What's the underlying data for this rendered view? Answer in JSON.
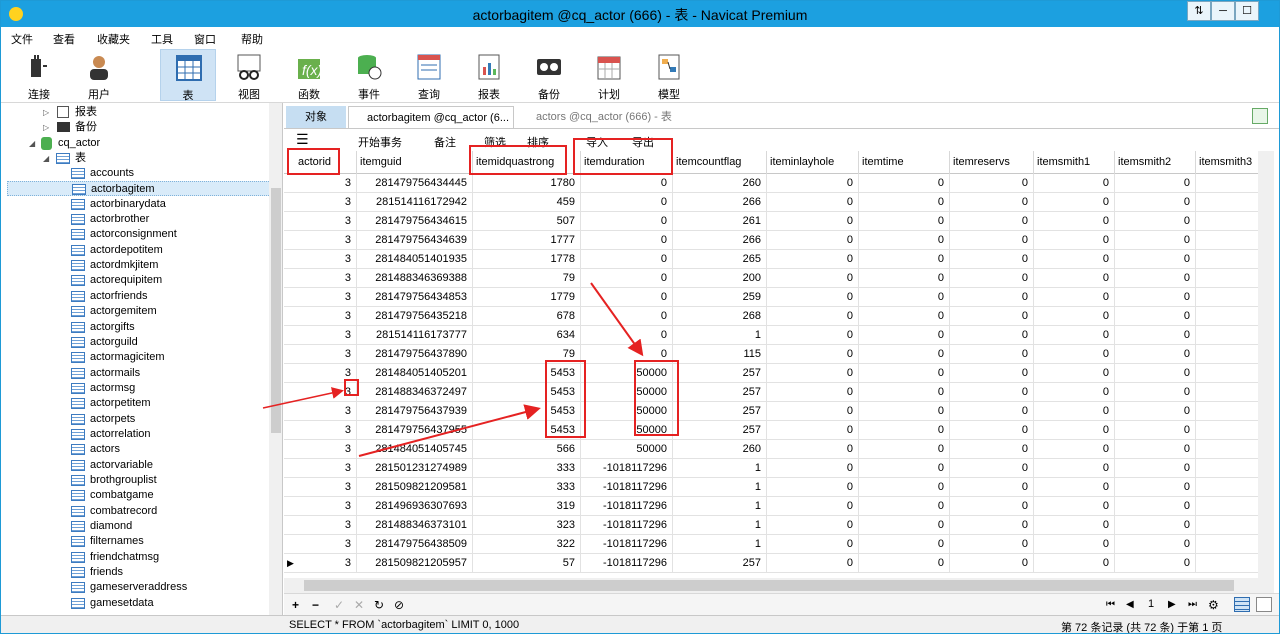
{
  "window": {
    "title": "actorbagitem @cq_actor (666) - 表 - Navicat Premium",
    "buttons": [
      "⇅",
      "─",
      "☐",
      "✕"
    ]
  },
  "menu": [
    "文件",
    "查看",
    "收藏夹",
    "工具",
    "窗口",
    "帮助"
  ],
  "toolbar": [
    {
      "label": "连接",
      "icon": "plug-icon"
    },
    {
      "label": "用户",
      "icon": "user-icon"
    },
    {
      "label": "表",
      "icon": "table-icon"
    },
    {
      "label": "视图",
      "icon": "view-icon"
    },
    {
      "label": "函数",
      "icon": "function-icon"
    },
    {
      "label": "事件",
      "icon": "event-icon"
    },
    {
      "label": "查询",
      "icon": "query-icon"
    },
    {
      "label": "报表",
      "icon": "report-icon"
    },
    {
      "label": "备份",
      "icon": "backup-icon"
    },
    {
      "label": "计划",
      "icon": "schedule-icon"
    },
    {
      "label": "模型",
      "icon": "model-icon"
    }
  ],
  "sidebar": {
    "top_items": [
      "报表",
      "备份"
    ],
    "database": "cq_actor",
    "tables_label": "表",
    "tables": [
      "accounts",
      "actorbagitem",
      "actorbinarydata",
      "actorbrother",
      "actorconsignment",
      "actordepotitem",
      "actordmkjitem",
      "actorequipitem",
      "actorfriends",
      "actorgemitem",
      "actorgifts",
      "actorguild",
      "actormagicitem",
      "actormails",
      "actormsg",
      "actorpetitem",
      "actorpets",
      "actorrelation",
      "actors",
      "actorvariable",
      "brothgrouplist",
      "combatgame",
      "combatrecord",
      "diamond",
      "filternames",
      "friendchatmsg",
      "friends",
      "gameserveraddress",
      "gamesetdata"
    ],
    "selected": "actorbagitem"
  },
  "tabs": {
    "objects": "对象",
    "active": "actorbagitem @cq_actor (6...",
    "inactive": "actors @cq_actor (666) - 表"
  },
  "subbar": {
    "menu": "☰",
    "begin_tx": "开始事务",
    "memo": "备注",
    "filter": "筛选",
    "sort": "排序",
    "import": "导入",
    "export": "导出"
  },
  "grid": {
    "columns": [
      "actorid",
      "itemguid",
      "itemidquastrong",
      "itemduration",
      "itemcountflag",
      "iteminlayhole",
      "itemtime",
      "itemreservs",
      "itemsmith1",
      "itemsmith2",
      "itemsmith3"
    ],
    "rows": [
      [
        "3",
        "281479756434445",
        "1780",
        "0",
        "260",
        "0",
        "0",
        "0",
        "0",
        "0",
        ""
      ],
      [
        "3",
        "281514116172942",
        "459",
        "0",
        "266",
        "0",
        "0",
        "0",
        "0",
        "0",
        ""
      ],
      [
        "3",
        "281479756434615",
        "507",
        "0",
        "261",
        "0",
        "0",
        "0",
        "0",
        "0",
        ""
      ],
      [
        "3",
        "281479756434639",
        "1777",
        "0",
        "266",
        "0",
        "0",
        "0",
        "0",
        "0",
        ""
      ],
      [
        "3",
        "281484051401935",
        "1778",
        "0",
        "265",
        "0",
        "0",
        "0",
        "0",
        "0",
        ""
      ],
      [
        "3",
        "281488346369388",
        "79",
        "0",
        "200",
        "0",
        "0",
        "0",
        "0",
        "0",
        ""
      ],
      [
        "3",
        "281479756434853",
        "1779",
        "0",
        "259",
        "0",
        "0",
        "0",
        "0",
        "0",
        ""
      ],
      [
        "3",
        "281479756435218",
        "678",
        "0",
        "268",
        "0",
        "0",
        "0",
        "0",
        "0",
        ""
      ],
      [
        "3",
        "281514116173777",
        "634",
        "0",
        "1",
        "0",
        "0",
        "0",
        "0",
        "0",
        ""
      ],
      [
        "3",
        "281479756437890",
        "79",
        "0",
        "115",
        "0",
        "0",
        "0",
        "0",
        "0",
        ""
      ],
      [
        "3",
        "281484051405201",
        "5453",
        "50000",
        "257",
        "0",
        "0",
        "0",
        "0",
        "0",
        ""
      ],
      [
        "3",
        "281488346372497",
        "5453",
        "50000",
        "257",
        "0",
        "0",
        "0",
        "0",
        "0",
        ""
      ],
      [
        "3",
        "281479756437939",
        "5453",
        "50000",
        "257",
        "0",
        "0",
        "0",
        "0",
        "0",
        ""
      ],
      [
        "3",
        "281479756437955",
        "5453",
        "50000",
        "257",
        "0",
        "0",
        "0",
        "0",
        "0",
        ""
      ],
      [
        "3",
        "281484051405745",
        "566",
        "50000",
        "260",
        "0",
        "0",
        "0",
        "0",
        "0",
        ""
      ],
      [
        "3",
        "281501231274989",
        "333",
        "-1018117296",
        "1",
        "0",
        "0",
        "0",
        "0",
        "0",
        ""
      ],
      [
        "3",
        "281509821209581",
        "333",
        "-1018117296",
        "1",
        "0",
        "0",
        "0",
        "0",
        "0",
        ""
      ],
      [
        "3",
        "281496936307693",
        "319",
        "-1018117296",
        "1",
        "0",
        "0",
        "0",
        "0",
        "0",
        ""
      ],
      [
        "3",
        "281488346373101",
        "323",
        "-1018117296",
        "1",
        "0",
        "0",
        "0",
        "0",
        "0",
        ""
      ],
      [
        "3",
        "281479756438509",
        "322",
        "-1018117296",
        "1",
        "0",
        "0",
        "0",
        "0",
        "0",
        ""
      ],
      [
        "3",
        "281509821205957",
        "57",
        "-1018117296",
        "257",
        "0",
        "0",
        "0",
        "0",
        "0",
        ""
      ]
    ],
    "current_row_marker": "▶"
  },
  "navbar": {
    "add": "+",
    "delete": "−",
    "apply": "✓",
    "cancel": "✕",
    "refresh": "↻",
    "stop": "⊘",
    "first": "⏮",
    "prev": "◀",
    "page": "1",
    "next": "▶",
    "last": "⏭",
    "settings": "⚙"
  },
  "status": {
    "sql": "SELECT * FROM `actorbagitem` LIMIT 0, 1000",
    "record_info": "第 72 条记录 (共 72 条) 于第 1 页"
  },
  "colors": {
    "titlebar": "#1ca0e0",
    "highlight": "#e52222",
    "selected_tab": "#c6def2"
  }
}
